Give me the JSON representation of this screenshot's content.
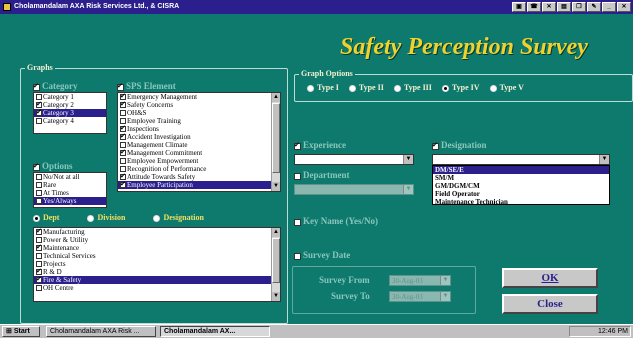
{
  "window": {
    "title": "Cholamandalam AXA Risk Services Ltd., & CISRA",
    "heading": "Safety Perception Survey"
  },
  "graphs": {
    "title": "Graphs",
    "category": {
      "label": "Category",
      "items": [
        {
          "label": "Category 1",
          "checked": false,
          "selected": false
        },
        {
          "label": "Category 2",
          "checked": true,
          "selected": false
        },
        {
          "label": "Category 3",
          "checked": true,
          "selected": true
        },
        {
          "label": "Category 4",
          "checked": false,
          "selected": false
        }
      ]
    },
    "options": {
      "label": "Options",
      "items": [
        {
          "label": "No/Not at all",
          "checked": false,
          "selected": false
        },
        {
          "label": "Rare",
          "checked": false,
          "selected": false
        },
        {
          "label": "At Times",
          "checked": false,
          "selected": false
        },
        {
          "label": "Yes/Always",
          "checked": false,
          "selected": true
        }
      ]
    },
    "sps_element": {
      "label": "SPS Element",
      "items": [
        {
          "label": "Emergency Management",
          "checked": true,
          "selected": false
        },
        {
          "label": "Safety Concerns",
          "checked": true,
          "selected": false
        },
        {
          "label": "OH&S",
          "checked": false,
          "selected": false
        },
        {
          "label": "Employee Training",
          "checked": false,
          "selected": false
        },
        {
          "label": "Inspections",
          "checked": true,
          "selected": false
        },
        {
          "label": "Accident Investigation",
          "checked": true,
          "selected": false
        },
        {
          "label": "Management Climate",
          "checked": false,
          "selected": false
        },
        {
          "label": "Management Commitment",
          "checked": true,
          "selected": false
        },
        {
          "label": "Employee Empowerment",
          "checked": false,
          "selected": false
        },
        {
          "label": "Recognition of Performance",
          "checked": false,
          "selected": false
        },
        {
          "label": "Attitude Towards Safety",
          "checked": true,
          "selected": false
        },
        {
          "label": "Employee Participation",
          "checked": true,
          "selected": true
        }
      ]
    },
    "scope_radios": [
      {
        "label": "Dept",
        "on": true
      },
      {
        "label": "Division",
        "on": false
      },
      {
        "label": "Designation",
        "on": false
      }
    ],
    "dept_list": {
      "items": [
        {
          "label": "Manufacturing",
          "checked": true,
          "selected": false
        },
        {
          "label": "Power & Utility",
          "checked": false,
          "selected": false
        },
        {
          "label": "Maintenance",
          "checked": true,
          "selected": false
        },
        {
          "label": "Technical Services",
          "checked": false,
          "selected": false
        },
        {
          "label": "Projects",
          "checked": false,
          "selected": false
        },
        {
          "label": "R & D",
          "checked": true,
          "selected": false
        },
        {
          "label": "Fire & Safety",
          "checked": true,
          "selected": true
        },
        {
          "label": "OH Centre",
          "checked": false,
          "selected": false
        }
      ]
    }
  },
  "graph_options": {
    "title": "Graph Options",
    "types": [
      {
        "label": "Type I",
        "on": false
      },
      {
        "label": "Type II",
        "on": false
      },
      {
        "label": "Type III",
        "on": false
      },
      {
        "label": "Type IV",
        "on": true
      },
      {
        "label": "Type V",
        "on": false
      }
    ]
  },
  "filters": {
    "experience": {
      "label": "Experience",
      "checked": true,
      "value": ""
    },
    "designation": {
      "label": "Designation",
      "checked": true,
      "value": "",
      "options": [
        "DM/SE/E",
        "SM/M",
        "GM/DGM/CM",
        "Field Operator",
        "Maintenance Technician"
      ]
    },
    "department": {
      "label": "Department",
      "checked": false,
      "value": ""
    },
    "key_name": {
      "label": "Key Name (Yes/No)",
      "checked": false
    },
    "survey_date": {
      "label": "Survey Date",
      "checked": false
    },
    "survey_from": {
      "label": "Survey From",
      "value": "30-Aug-03"
    },
    "survey_to": {
      "label": "Survey To",
      "value": "30-Aug-03"
    }
  },
  "buttons": {
    "ok": "OK",
    "close": "Close"
  },
  "taskbar": {
    "start": "Start",
    "tasks": [
      "Cholamandalam AXA Risk ...",
      "Cholamandalam AX..."
    ],
    "clock": "12:46 PM"
  }
}
